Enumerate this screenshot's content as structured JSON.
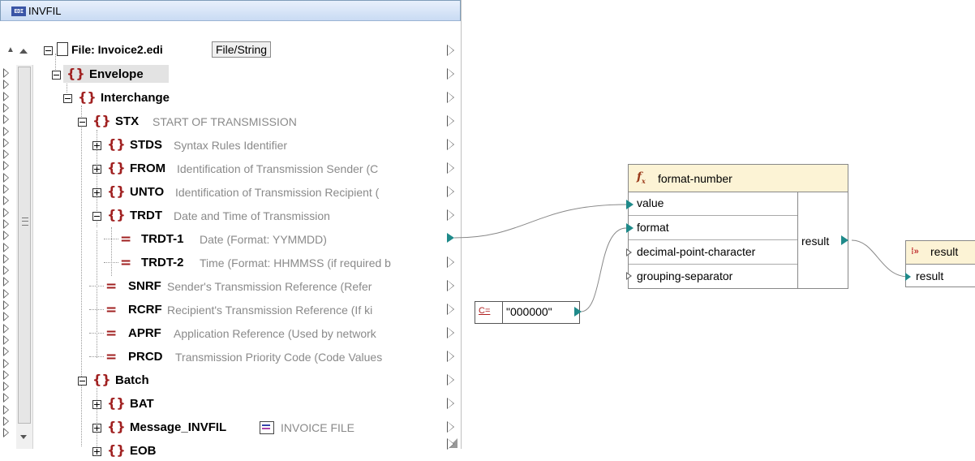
{
  "source": {
    "title": "INVFIL",
    "title_icon": "EDI",
    "file_row": {
      "label": "File: Invoice2.edi",
      "button": "File/String"
    },
    "rows": [
      {
        "name": "Envelope"
      },
      {
        "name": "Interchange"
      },
      {
        "name": "STX",
        "desc": "START OF TRANSMISSION"
      },
      {
        "name": "STDS",
        "desc": "Syntax Rules Identifier"
      },
      {
        "name": "FROM",
        "desc": "Identification of Transmission Sender (C"
      },
      {
        "name": "UNTO",
        "desc": "Identification of Transmission Recipient ("
      },
      {
        "name": "TRDT",
        "desc": "Date and Time of Transmission"
      },
      {
        "name": "TRDT-1",
        "desc": "Date (Format: YYMMDD)"
      },
      {
        "name": "TRDT-2",
        "desc": "Time (Format: HHMMSS (if required b"
      },
      {
        "name": "SNRF",
        "desc": "Sender's Transmission Reference (Refer"
      },
      {
        "name": "RCRF",
        "desc": "Recipient's Transmission Reference (If ki"
      },
      {
        "name": "APRF",
        "desc": "Application Reference (Used by network"
      },
      {
        "name": "PRCD",
        "desc": "Transmission Priority Code (Code Values"
      },
      {
        "name": "Batch"
      },
      {
        "name": "BAT"
      },
      {
        "name": "Message_INVFIL",
        "desc": "INVOICE FILE"
      },
      {
        "name": "EOB"
      }
    ]
  },
  "function": {
    "title": "format-number",
    "icon": "function-icon",
    "params": [
      "value",
      "format",
      "decimal-point-character",
      "grouping-separator"
    ],
    "output": "result"
  },
  "constant": {
    "icon": "C=",
    "value": "\"000000\""
  },
  "target": {
    "title": "result",
    "item": "result"
  },
  "colors": {
    "connector": "#1f8a8a",
    "element": "#a02020",
    "header": "#fcf3d5"
  }
}
